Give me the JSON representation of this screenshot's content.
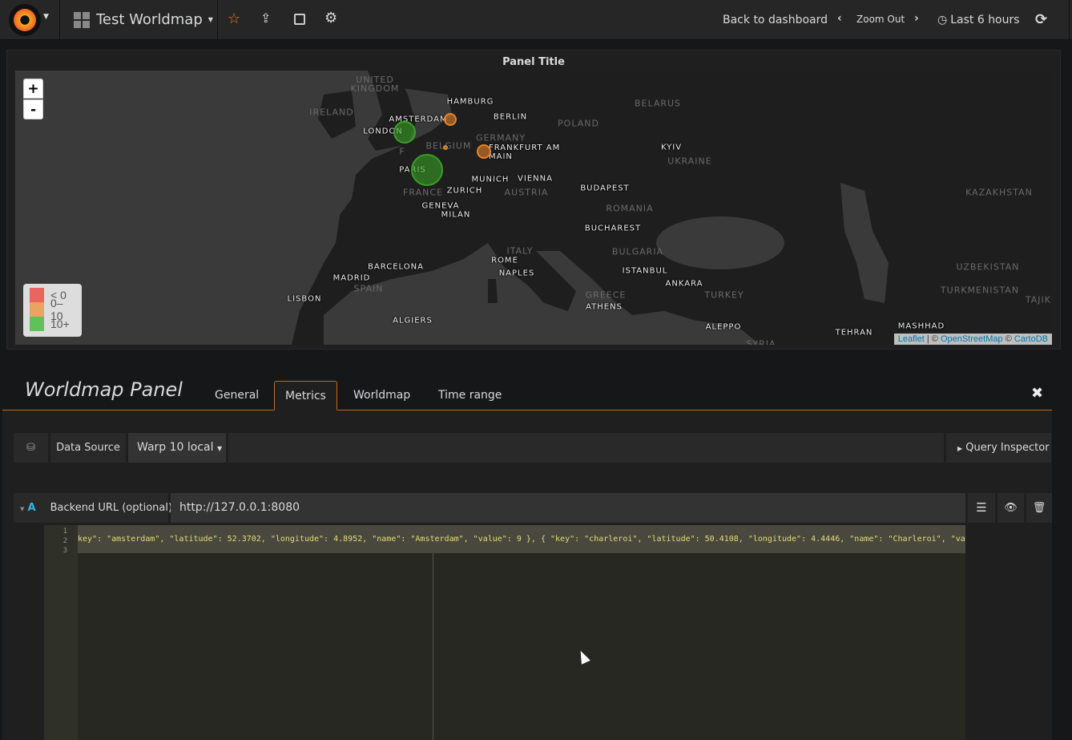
{
  "topnav": {
    "dashboard_title": "Test Worldmap",
    "back_label": "Back to dashboard",
    "zoom_out_label": "Zoom Out",
    "time_range_label": "Last 6 hours"
  },
  "panel": {
    "title": "Panel Title"
  },
  "map": {
    "zoom_in": "+",
    "zoom_out": "-",
    "countries": [
      "UNITED KINGDOM",
      "IRELAND",
      "BELGIUM",
      "GERMANY",
      "FRANCE",
      "AUSTRIA",
      "POLAND",
      "BELARUS",
      "UKRAINE",
      "ROMANIA",
      "BULGARIA",
      "ITALY",
      "SPAIN",
      "GREECE",
      "TURKEY",
      "KAZAKHSTAN",
      "UZBEKISTAN",
      "TURKMENISTAN",
      "TAJIKI",
      "SYRIA",
      "F"
    ],
    "cities": [
      "HAMBURG",
      "BERLIN",
      "AMSTERDAM",
      "LONDON",
      "FRANKFURT AM MAIN",
      "PARIS",
      "MUNICH",
      "VIENNA",
      "ZURICH",
      "BUDAPEST",
      "GENEVA",
      "MILAN",
      "KYIV",
      "BUCHAREST",
      "BARCELONA",
      "ROME",
      "NAPLES",
      "MADRID",
      "LISBON",
      "ISTANBUL",
      "ANKARA",
      "ATHENS",
      "ALGIERS",
      "ALEPPO",
      "TEHRAN",
      "MASHHAD"
    ],
    "markers": [
      {
        "name": "London",
        "color": "#37a023"
      },
      {
        "name": "Paris",
        "color": "#37a023"
      },
      {
        "name": "Amsterdam",
        "color": "#e5822a"
      },
      {
        "name": "Charleroi",
        "color": "#e5822a"
      },
      {
        "name": "Frankfurt",
        "color": "#e5822a"
      }
    ],
    "legend": [
      {
        "label": "< 0",
        "color": "#ea6460"
      },
      {
        "label": "0–10",
        "color": "#eba35f"
      },
      {
        "label": "10+",
        "color": "#5ec15a"
      }
    ],
    "attribution": {
      "leaflet": "Leaflet",
      "sep1": " | © ",
      "osm": "OpenStreetMap",
      "sep2": " © ",
      "carto": "CartoDB"
    }
  },
  "editor": {
    "title": "Worldmap Panel",
    "tabs": [
      "General",
      "Metrics",
      "Worldmap",
      "Time range"
    ],
    "active_tab": "Metrics",
    "datasource_label": "Data Source",
    "datasource_value": "Warp 10 local",
    "query_inspector": "Query Inspector",
    "query": {
      "ref": "A",
      "backend_label": "Backend URL (optional)",
      "backend_value": "http://127.0.0.1:8080"
    },
    "code": {
      "line_numbers": [
        "1",
        "2",
        "3"
      ],
      "line2": "key\": \"amsterdam\", \"latitude\": 52.3702, \"longitude\": 4.8952, \"name\": \"Amsterdam\", \"value\": 9 }, { \"key\": \"charleroi\", \"latitude\": 50.4108, \"longitude\": 4.4446, \"name\": \"Charleroi\", \"val"
    }
  }
}
